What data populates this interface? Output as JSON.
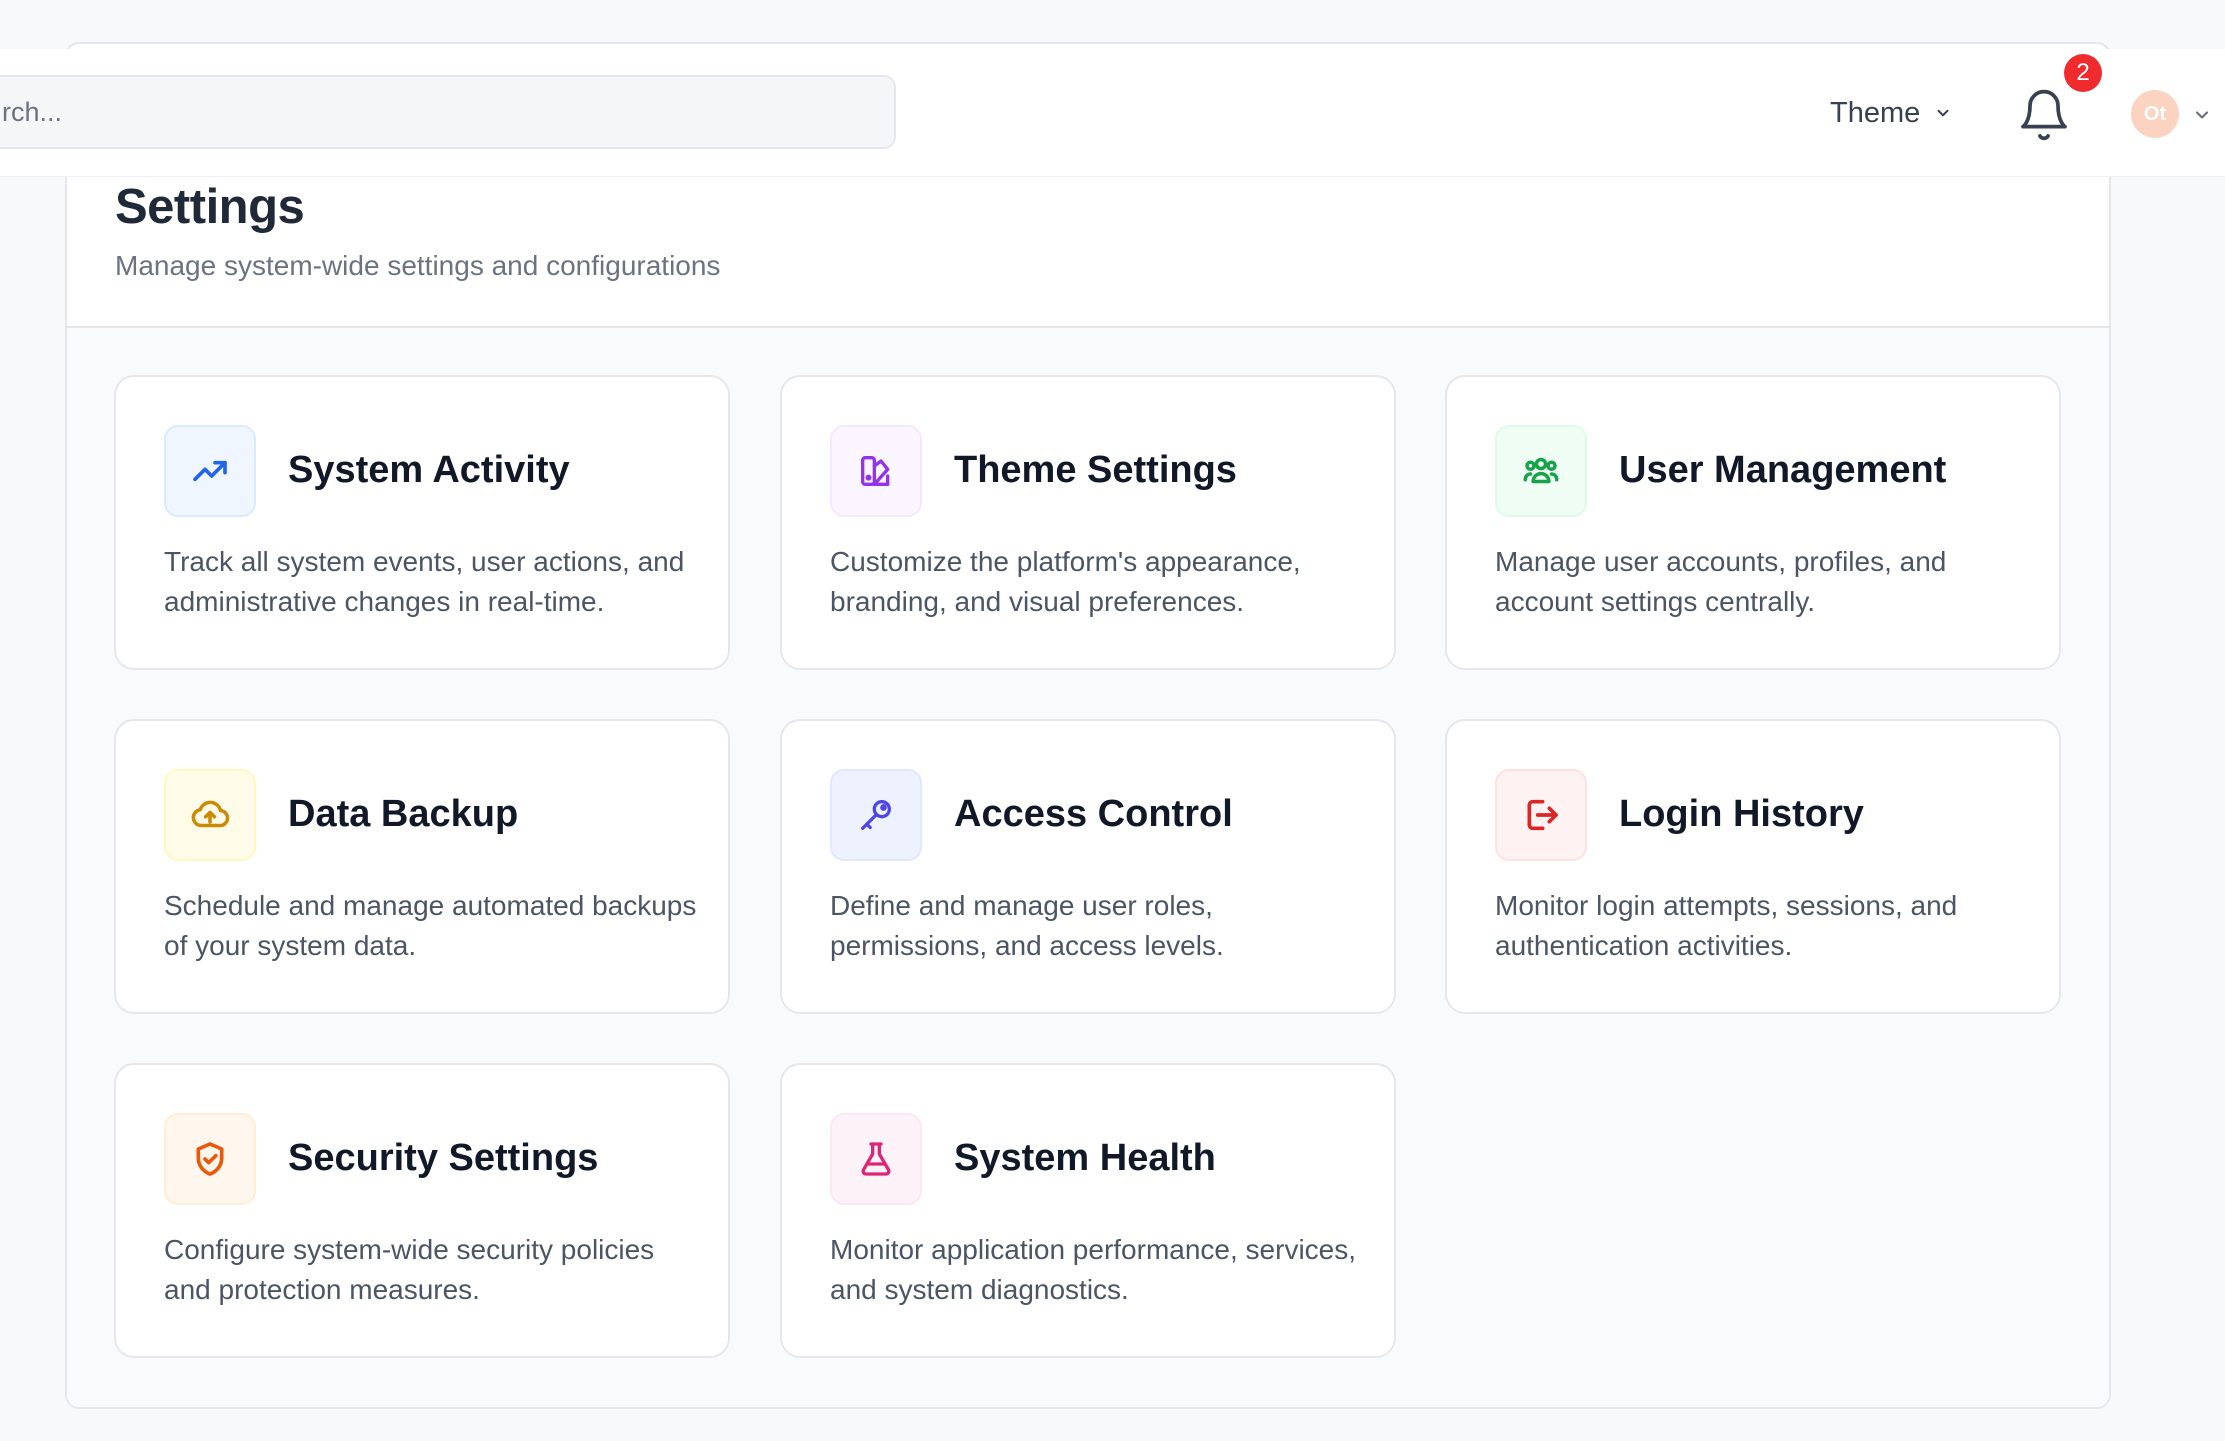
{
  "header": {
    "search_placeholder": "rch...",
    "theme_label": "Theme",
    "notification_count": "2",
    "avatar_initials": "Ot"
  },
  "page": {
    "title": "Settings",
    "subtitle": "Manage system-wide settings and configurations"
  },
  "cards": [
    {
      "title": "System Activity",
      "description": "Track all system events, user actions, and administrative changes in real-time.",
      "icon": "trending-up-icon",
      "accent": "#2563eb"
    },
    {
      "title": "Theme Settings",
      "description": "Customize the platform's appearance, branding, and visual preferences.",
      "icon": "palette-icon",
      "accent": "#9333ea"
    },
    {
      "title": "User Management",
      "description": "Manage user accounts, profiles, and account settings centrally.",
      "icon": "users-icon",
      "accent": "#16a34a"
    },
    {
      "title": "Data Backup",
      "description": "Schedule and manage automated backups of your system data.",
      "icon": "cloud-upload-icon",
      "accent": "#ca8a04"
    },
    {
      "title": "Access Control",
      "description": "Define and manage user roles, permissions, and access levels.",
      "icon": "key-icon",
      "accent": "#4f46e5"
    },
    {
      "title": "Login History",
      "description": "Monitor login attempts, sessions, and authentication activities.",
      "icon": "login-icon",
      "accent": "#dc2626"
    },
    {
      "title": "Security Settings",
      "description": "Configure system-wide security policies and protection measures.",
      "icon": "shield-check-icon",
      "accent": "#ea580c"
    },
    {
      "title": "System Health",
      "description": "Monitor application performance, services, and system diagnostics.",
      "icon": "flask-icon",
      "accent": "#db2777"
    }
  ]
}
